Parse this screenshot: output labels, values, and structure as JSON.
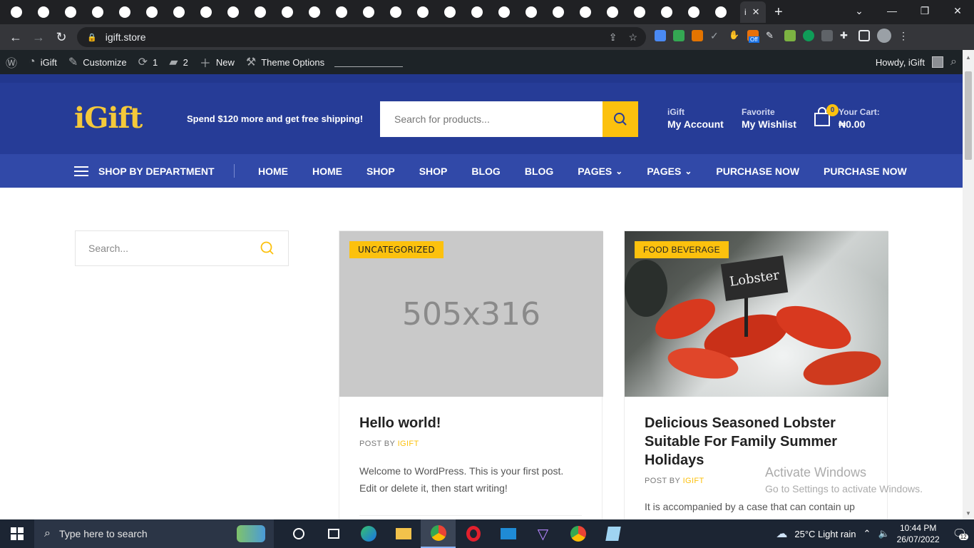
{
  "browser": {
    "active_tab_title": "i",
    "url": "igift.store",
    "tab_icons": [
      "globe-icon",
      "globe-icon",
      "gmail-icon",
      "cloud-icon",
      "globe-icon",
      "nu-icon",
      "eagle-icon",
      "eagle-icon",
      "eagle-icon",
      "drop-icon",
      "flame-icon",
      "image-icon",
      "w-icon",
      "flame-icon",
      "flame-icon",
      "edge-icon",
      "globe-icon",
      "bolt-icon",
      "link-icon",
      "chrome-icon",
      "p-icon",
      "cloudflare-icon",
      "globe-icon",
      "globe-icon",
      "sheet-icon",
      "globe-icon",
      "book-icon"
    ],
    "new_tab_label": "+",
    "ext_badge": "Off"
  },
  "adminbar": {
    "site_name": "iGift",
    "customize": "Customize",
    "updates_count": "1",
    "comments_count": "2",
    "new_label": "New",
    "theme_options": "Theme Options",
    "howdy": "Howdy, iGift"
  },
  "header": {
    "logo": "iGift",
    "promo": "Spend $120 more and get free shipping!",
    "search_placeholder": "Search for products...",
    "account_small": "iGift",
    "account_big": "My Account",
    "wishlist_small": "Favorite",
    "wishlist_big": "My Wishlist",
    "cart_count": "0",
    "cart_label": "Your Cart:",
    "cart_total": "₦0.00"
  },
  "nav": {
    "department": "SHOP BY DEPARTMENT",
    "links": [
      {
        "label": "HOME",
        "dropdown": false
      },
      {
        "label": "HOME",
        "dropdown": false
      },
      {
        "label": "SHOP",
        "dropdown": false
      },
      {
        "label": "SHOP",
        "dropdown": false
      },
      {
        "label": "BLOG",
        "dropdown": false
      },
      {
        "label": "BLOG",
        "dropdown": false
      },
      {
        "label": "PAGES",
        "dropdown": true
      },
      {
        "label": "PAGES",
        "dropdown": true
      },
      {
        "label": "PURCHASE NOW",
        "dropdown": false
      },
      {
        "label": "PURCHASE NOW",
        "dropdown": false
      }
    ]
  },
  "sidebar": {
    "search_placeholder": "Search..."
  },
  "posts": [
    {
      "tag": "UNCATEGORIZED",
      "image_text": "505x316",
      "title": "Hello world!",
      "meta_prefix": "POST BY",
      "author": "IGIFT",
      "excerpt": "Welcome to WordPress. This is your first post. Edit or delete it, then start writing!"
    },
    {
      "tag": "FOOD BEVERAGE",
      "sign_text": "Lobster",
      "title": "Delicious Seasoned Lobster Suitable For Family Summer Holidays",
      "meta_prefix": "POST BY",
      "author": "IGIFT",
      "excerpt": "It is accompanied by a case that can contain up"
    }
  ],
  "watermark": {
    "line1": "Activate Windows",
    "line2": "Go to Settings to activate Windows."
  },
  "taskbar": {
    "search_placeholder": "Type here to search",
    "weather": "25°C  Light rain",
    "time": "10:44 PM",
    "date": "26/07/2022",
    "notifications": "12"
  },
  "colors": {
    "brand_blue": "#263c97",
    "nav_blue": "#3149a8",
    "accent": "#fcc10e"
  }
}
